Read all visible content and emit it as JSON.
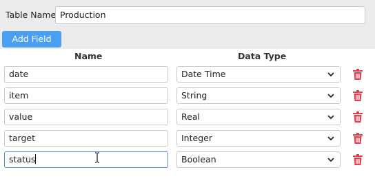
{
  "form": {
    "table_name_label": "Table Name",
    "table_name_value": "Production",
    "add_field_label": "Add Field"
  },
  "columns": {
    "name_header": "Name",
    "type_header": "Data Type"
  },
  "fields": [
    {
      "name": "date",
      "type": "Date Time"
    },
    {
      "name": "item",
      "type": "String"
    },
    {
      "name": "value",
      "type": "Real"
    },
    {
      "name": "target",
      "type": "Integer"
    },
    {
      "name": "status",
      "type": "Boolean"
    }
  ],
  "colors": {
    "accent": "#4a9ff5",
    "delete": "#e0414d",
    "focus": "#4a90d9"
  },
  "icons": {
    "delete": "trash-icon",
    "dropdown": "chevron-down-icon",
    "cursor": "text-cursor-icon"
  }
}
